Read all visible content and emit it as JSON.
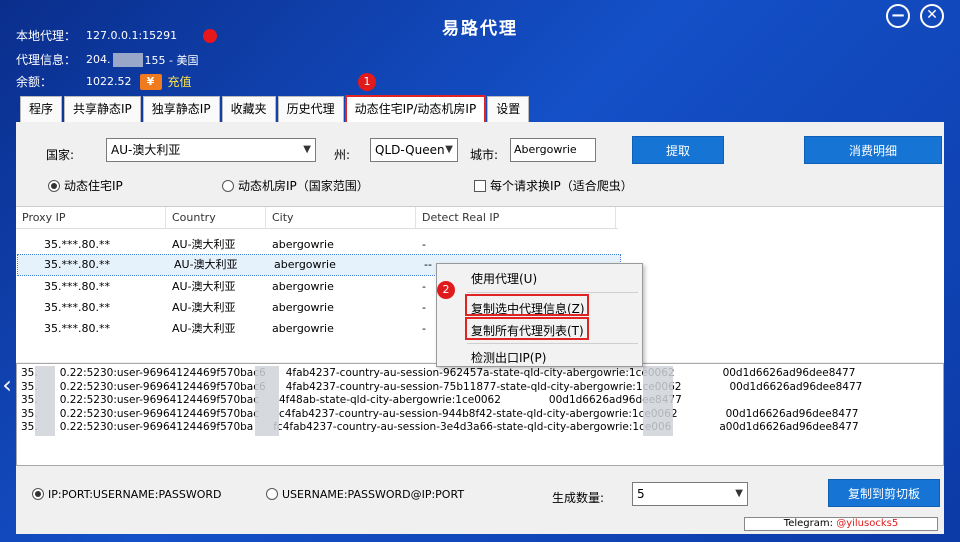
{
  "window": {
    "title": "易路代理",
    "minimize_symbol": "−",
    "close_symbol": "✕"
  },
  "info": {
    "local_proxy_label": "本地代理：",
    "local_proxy_value": "127.0.0.1:15291",
    "proxy_info_label": "代理信息：",
    "proxy_info_prefix": "204.",
    "proxy_info_suffix": "155 - 美国",
    "balance_label": "余额：",
    "balance_value": "1022.52",
    "topup_icon_text": "¥",
    "topup_label": "充值"
  },
  "badges": {
    "one": "1",
    "two": "2"
  },
  "tabs": [
    "程序",
    "共享静态IP",
    "独享静态IP",
    "收藏夹",
    "历史代理",
    "动态住宅IP/动态机房IP",
    "设置"
  ],
  "active_tab": "动态住宅IP/动态机房IP",
  "form": {
    "country_label": "国家:",
    "country_value": "AU-澳大利亚",
    "state_label": "州:",
    "state_value": "QLD-Queen",
    "city_label": "城市:",
    "city_value": "Abergowrie",
    "extract_button": "提取",
    "billing_button": "消费明细",
    "radio_residential": "动态住宅IP",
    "radio_datacenter": "动态机房IP（国家范围）",
    "checkbox_each_request": "每个请求换IP（适合爬虫）"
  },
  "table": {
    "columns": [
      "Proxy IP",
      "Country",
      "City",
      "Detect Real IP"
    ],
    "rows": [
      [
        "35.***.80.**",
        "AU-澳大利亚",
        "abergowrie",
        "-"
      ],
      [
        "35.***.80.**",
        "AU-澳大利亚",
        "abergowrie",
        "--"
      ],
      [
        "35.***.80.**",
        "AU-澳大利亚",
        "abergowrie",
        "-"
      ],
      [
        "35.***.80.**",
        "AU-澳大利亚",
        "abergowrie",
        "-"
      ],
      [
        "35.***.80.**",
        "AU-澳大利亚",
        "abergowrie",
        "-"
      ]
    ]
  },
  "context_menu": {
    "use_proxy": "使用代理(U)",
    "copy_selected": "复制选中代理信息(Z)",
    "copy_all": "复制所有代理列表(T)",
    "detect_exit": "检测出口IP(P)"
  },
  "output_lines": [
    {
      "left": "35.",
      "mid": "0.22:5230:user-96964124469f570bac6",
      "mid2": "4fab4237-country-au-session-962457a-state-qld-city-abergowrie:1ce0062",
      "tail": "00d1d6626ad96dee8477"
    },
    {
      "left": "35.",
      "mid": "0.22:5230:user-96964124469f570bac6",
      "mid2": "4fab4237-country-au-session-75b11877-state-qld-city-abergowrie:1ce0062",
      "tail": "00d1d6626ad96dee8477"
    },
    {
      "left": "35.",
      "mid": "0.22:5230:user-96964124469f570bac",
      "mid2": "4f48ab-state-qld-city-abergowrie:1ce0062",
      "tail": "00d1d6626ad96dee8477"
    },
    {
      "left": "35.",
      "mid": "0.22:5230:user-96964124469f570bac",
      "mid2": "c4fab4237-country-au-session-944b8f42-state-qld-city-abergowrie:1ce0062",
      "tail": "00d1d6626ad96dee8477"
    },
    {
      "left": "35.",
      "mid": "0.22:5230:user-96964124469f570ba",
      "mid2": "fc4fab4237-country-au-session-3e4d3a66-state-qld-city-abergowrie:1ce006",
      "tail": "a00d1d6626ad96dee8477"
    }
  ],
  "bottom": {
    "format_a": "IP:PORT:USERNAME:PASSWORD",
    "format_b": "USERNAME:PASSWORD@IP:PORT",
    "quantity_label": "生成数量:",
    "quantity_value": "5",
    "copy_button": "复制到剪切板"
  },
  "telegram": {
    "label": "Telegram:",
    "handle": "@yilusocks5"
  },
  "icons": {
    "left_nav": "‹"
  },
  "colors": {
    "accent_red": "#e02424",
    "button_blue": "#1574d4",
    "bg_blue": "#1450c8"
  }
}
